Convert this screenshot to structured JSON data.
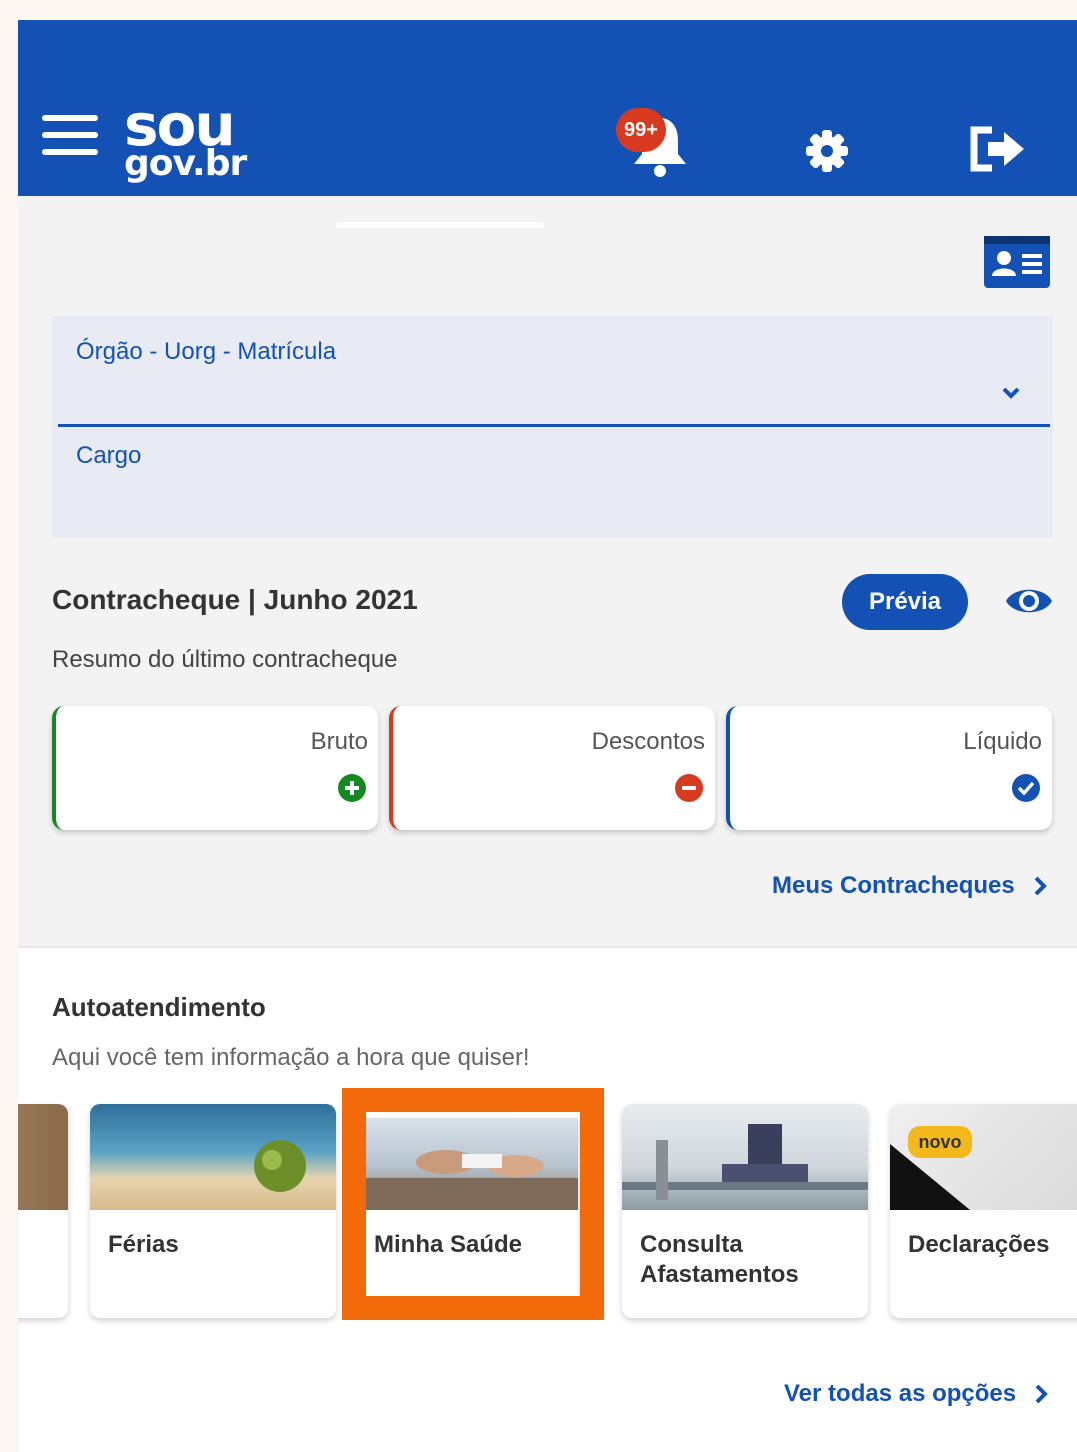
{
  "header": {
    "logo_line1": "sou",
    "logo_line2": "gov.br",
    "notifications_badge": "99+",
    "brand_color": "#1351b4"
  },
  "form": {
    "field1_label": "Órgão - Uorg - Matrícula",
    "field2_label": "Cargo"
  },
  "contracheque": {
    "title": "Contracheque | Junho 2021",
    "preview_button": "Prévia",
    "subtitle": "Resumo do último contracheque",
    "cards": [
      {
        "label": "Bruto",
        "icon": "plus-circle-icon",
        "color": "#168821"
      },
      {
        "label": "Descontos",
        "icon": "minus-circle-icon",
        "color": "#d83a1f"
      },
      {
        "label": "Líquido",
        "icon": "check-circle-icon",
        "color": "#1351b4"
      }
    ],
    "link": "Meus Contracheques"
  },
  "autoatendimento": {
    "title": "Autoatendimento",
    "subtitle": "Aqui você tem informação a hora que quiser!",
    "services": [
      {
        "title": "Férias"
      },
      {
        "title": "Minha Saúde"
      },
      {
        "title": "Consulta\nAfastamentos"
      },
      {
        "title": "Declarações",
        "badge": "novo"
      }
    ],
    "highlight_color": "#f26a0a",
    "link": "Ver todas as opções"
  }
}
